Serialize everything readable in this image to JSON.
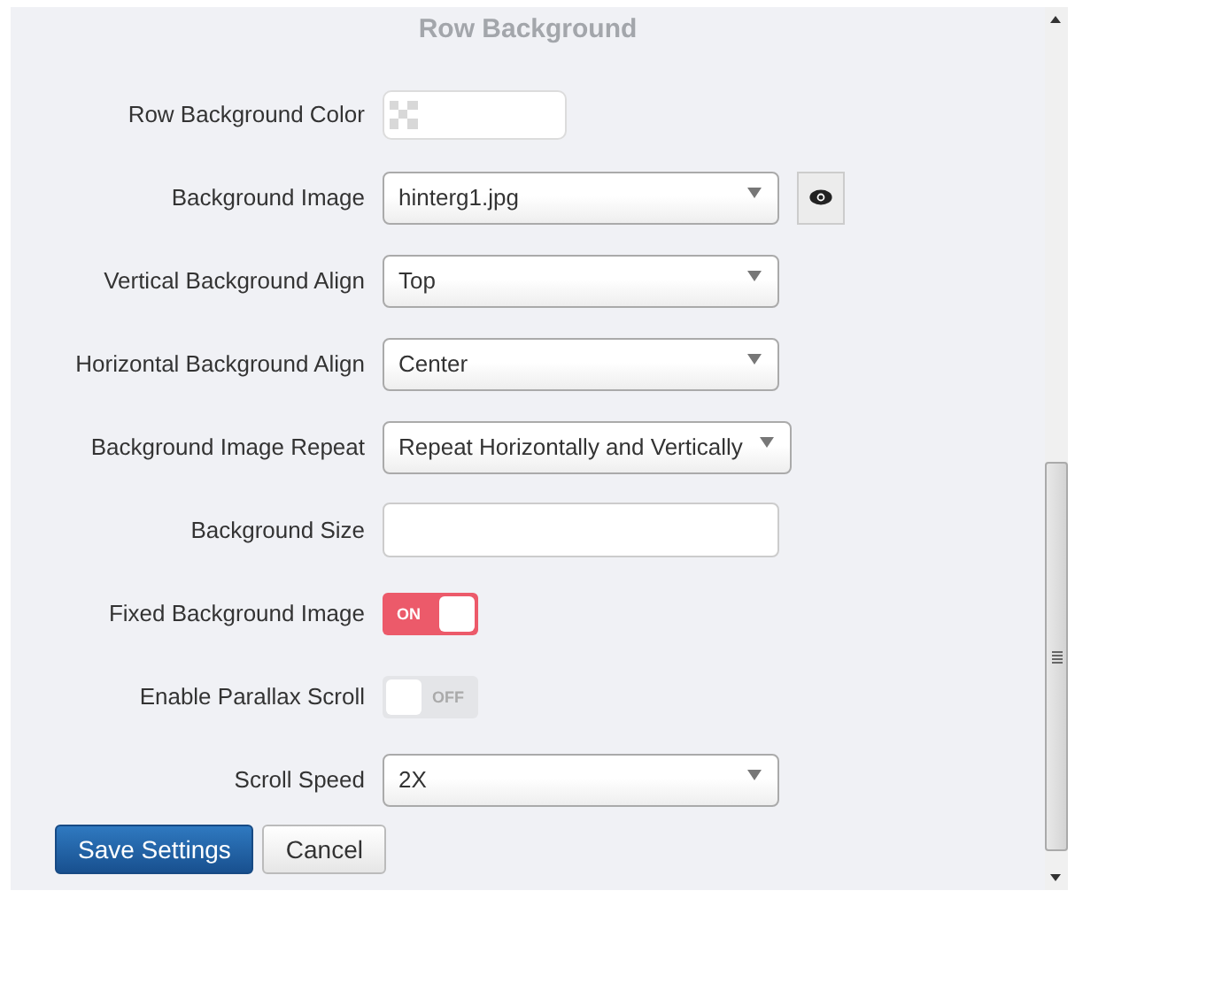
{
  "section_title": "Row Background",
  "fields": [
    {
      "kind": "color",
      "label": "Row Background Color"
    },
    {
      "kind": "select",
      "label": "Background Image",
      "value": "hinterg1.jpg",
      "preview_button": true
    },
    {
      "kind": "select",
      "label": "Vertical Background Align",
      "value": "Top"
    },
    {
      "kind": "select",
      "label": "Horizontal Background Align",
      "value": "Center"
    },
    {
      "kind": "select",
      "label": "Background Image Repeat",
      "value": "Repeat Horizontally and Vertically"
    },
    {
      "kind": "text",
      "label": "Background Size"
    },
    {
      "kind": "toggle",
      "label": "Fixed Background Image",
      "on": true,
      "state_text": "ON"
    },
    {
      "kind": "toggle",
      "label": "Enable Parallax Scroll",
      "on": false,
      "state_text": "OFF"
    },
    {
      "kind": "select",
      "label": "Scroll Speed",
      "value": "2X"
    }
  ],
  "buttons": [
    {
      "kind": "primary",
      "label": "Save Settings"
    },
    {
      "kind": "default",
      "label": "Cancel"
    }
  ]
}
